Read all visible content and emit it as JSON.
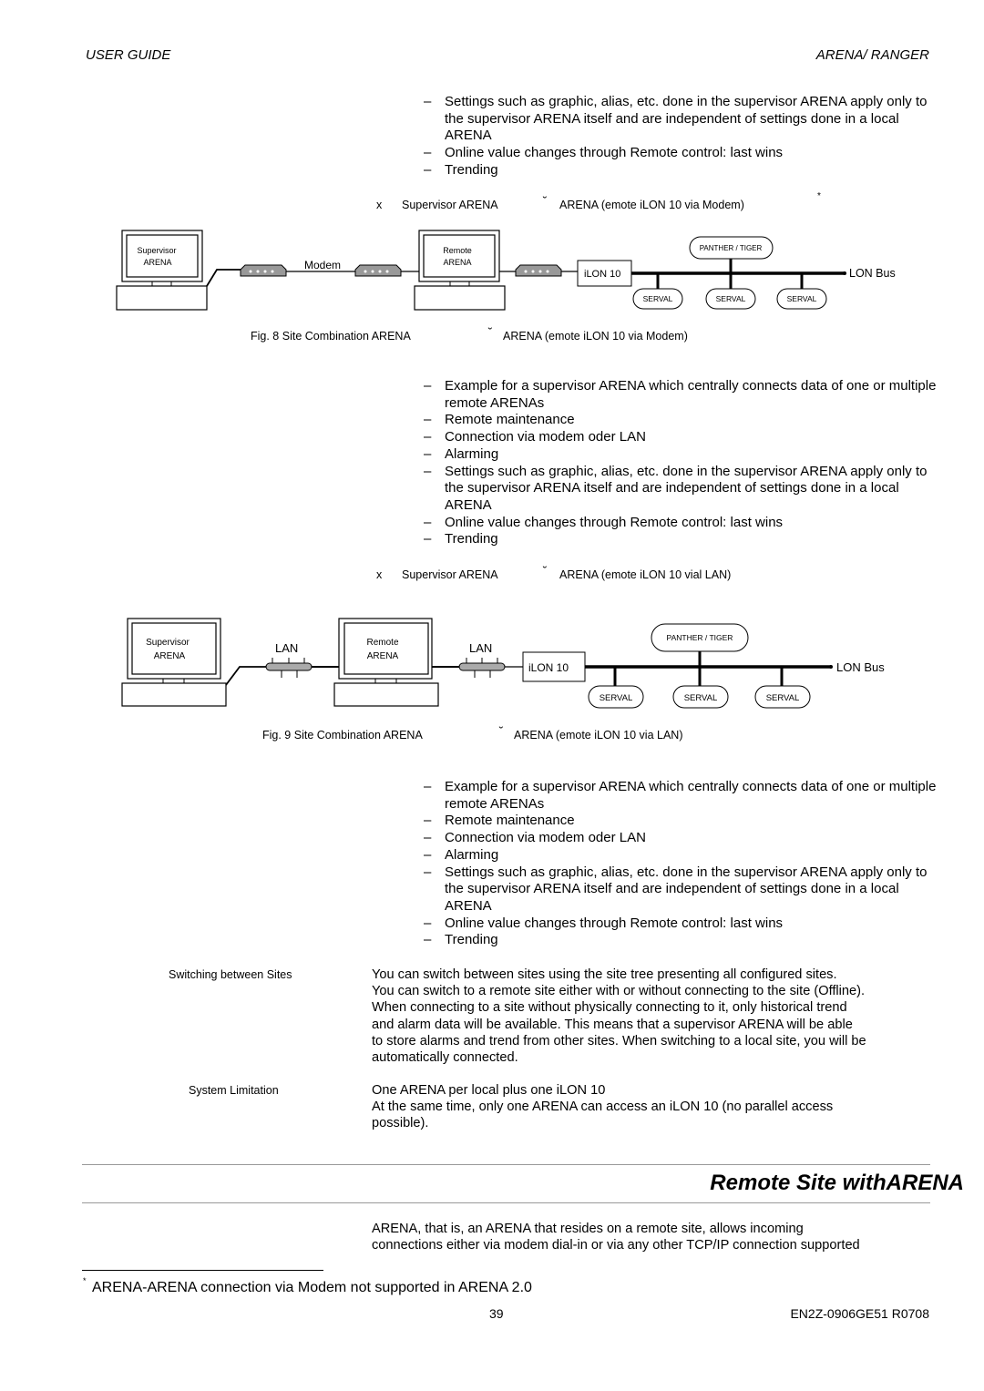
{
  "header": {
    "left": "USER GUIDE",
    "right": "ARENA/ RANGER"
  },
  "block1": [
    {
      "dash": "–",
      "text": "Settings such as graphic, alias, etc. done in the supervisor ARENA apply only to the supervisor ARENA itself and are independent of settings done in a local ARENA"
    },
    {
      "dash": "–",
      "text": "Online value changes through Remote control: last wins"
    },
    {
      "dash": "–",
      "text": "Trending"
    }
  ],
  "heading1": {
    "bullet": "x",
    "left": "Supervisor ARENA",
    "sym": "˘",
    "right": "ARENA (emote iLON 10 via Modem)",
    "footnote_mark": "*"
  },
  "fig8": {
    "supervisor_l1": "Supervisor",
    "supervisor_l2": "ARENA",
    "modem_label": "Modem",
    "remote_l1": "Remote",
    "remote_l2": "ARENA",
    "ilon": "iLON 10",
    "panther": "PANTHER / TIGER",
    "serval": [
      "SERVAL",
      "SERVAL",
      "SERVAL"
    ],
    "bus": "LON Bus",
    "caption_left": "Fig. 8 Site Combination ARENA",
    "caption_sym": "˘",
    "caption_right": "ARENA (emote iLON 10 via Modem)"
  },
  "block2": [
    {
      "dash": "–",
      "text": "Example for a supervisor ARENA which centrally connects data of one or multiple remote ARENAs"
    },
    {
      "dash": "–",
      "text": "Remote maintenance"
    },
    {
      "dash": "–",
      "text": "Connection via modem oder LAN"
    },
    {
      "dash": "–",
      "text": "Alarming"
    },
    {
      "dash": "–",
      "text": "Settings such as graphic, alias, etc. done in the supervisor ARENA apply only to the supervisor ARENA itself and are independent of settings done in a local ARENA"
    },
    {
      "dash": "–",
      "text": "Online value changes through Remote control: last wins"
    },
    {
      "dash": "–",
      "text": "Trending"
    }
  ],
  "heading2": {
    "bullet": "x",
    "left": "Supervisor ARENA",
    "sym": "˘",
    "right": "ARENA (emote iLON 10 vial LAN)"
  },
  "fig9": {
    "supervisor_l1": "Supervisor",
    "supervisor_l2": "ARENA",
    "lan1": "LAN",
    "remote_l1": "Remote",
    "remote_l2": "ARENA",
    "lan2": "LAN",
    "ilon": "iLON 10",
    "panther": "PANTHER / TIGER",
    "serval": [
      "SERVAL",
      "SERVAL",
      "SERVAL"
    ],
    "bus": "LON Bus",
    "caption_left": "Fig. 9 Site Combination ARENA",
    "caption_sym": "˘",
    "caption_right": "ARENA (emote iLON 10 via LAN)"
  },
  "block3": [
    {
      "dash": "–",
      "text": "Example for a supervisor ARENA which centrally connects data of one or multiple remote ARENAs"
    },
    {
      "dash": "–",
      "text": "Remote maintenance"
    },
    {
      "dash": "–",
      "text": "Connection via modem oder LAN"
    },
    {
      "dash": "–",
      "text": "Alarming"
    },
    {
      "dash": "–",
      "text": "Settings such as graphic, alias, etc. done in the supervisor ARENA apply only to the supervisor ARENA itself and are independent of settings done in a local ARENA"
    },
    {
      "dash": "–",
      "text": "Online value changes through Remote control: last wins"
    },
    {
      "dash": "–",
      "text": "Trending"
    }
  ],
  "switching": {
    "label": "Switching between Sites",
    "lines": [
      "You can switch between sites using the site tree presenting all configured sites.",
      "You can switch to a remote site either with or without connecting to the site (Offline).",
      "When connecting to a site without physically connecting to it, only historical trend",
      "and alarm data will be available. This means that a supervisor ARENA will be able",
      "to store alarms and trend from other sites. When switching to a local site, you will be",
      "automatically connected."
    ]
  },
  "limitation": {
    "label": "System Limitation",
    "lines": [
      "One ARENA per local plus one iLON 10",
      "At the same time, only one ARENA can access an iLON 10 (no parallel access",
      "possible)."
    ]
  },
  "section_title": "Remote Site withARENA",
  "section_text": [
    "ARENA, that is, an ARENA that resides on a remote site, allows incoming",
    "connections either via modem dial-in or via any other TCP/IP connection supported"
  ],
  "footnote": {
    "mark": "*",
    "text": "ARENA-ARENA connection via Modem not supported in ARENA 2.0"
  },
  "footer": {
    "page": "39",
    "doc_id": "EN2Z-0906GE51 R0708"
  }
}
